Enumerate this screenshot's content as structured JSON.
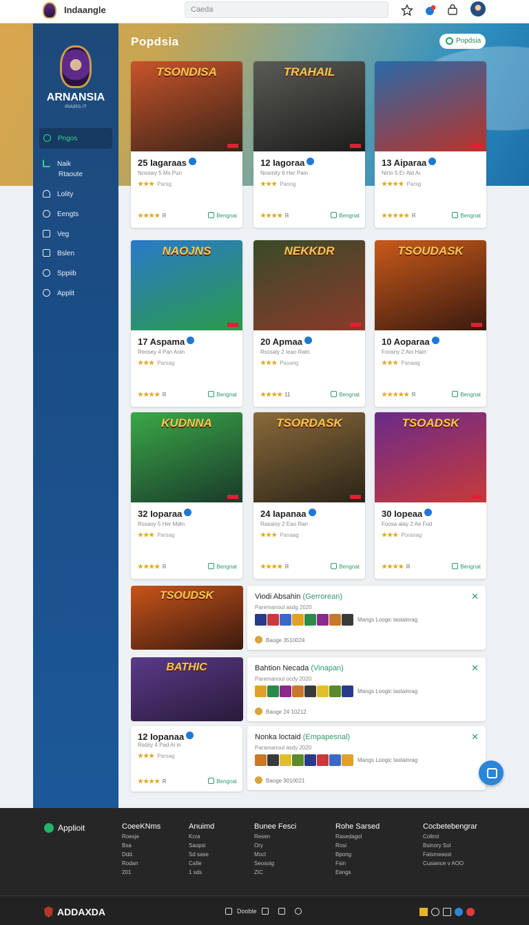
{
  "topbar": {
    "app_name": "Indaangle",
    "search_placeholder": "Caeda"
  },
  "hero": {
    "heading": "Popdsia",
    "button_label": "Popdsia"
  },
  "sidebar": {
    "title": "ARNANSIA",
    "subtitle": "IRAIRS·IT",
    "items": [
      {
        "label": "Pngos",
        "icon": "search-icon"
      },
      {
        "label": "Naik",
        "icon": "chart-icon"
      },
      {
        "label": "Rtaoute",
        "icon": ""
      },
      {
        "label": "Lolity",
        "icon": "user-icon"
      },
      {
        "label": "Eengts",
        "icon": "dollar-icon"
      },
      {
        "label": "Veg",
        "icon": "video-icon"
      },
      {
        "label": "Bslen",
        "icon": "list-icon"
      },
      {
        "label": "Sppiib",
        "icon": "play-icon"
      },
      {
        "label": "Applit",
        "icon": "link-icon"
      }
    ]
  },
  "cards": [
    {
      "art": "TSONDISA",
      "title": "25 Iagaraas",
      "meta": "Nosswy 5 Ms Pun",
      "stars": "★★★",
      "rating_note": "Parsg",
      "rating": "★★★★",
      "rating_count": "Я",
      "action": "Bengnat",
      "colors": [
        "#c8542a",
        "#3a2418"
      ]
    },
    {
      "art": "TRAHAIL",
      "title": "12 Iagoraa",
      "meta": "Nosmity 6 Her Pain",
      "stars": "★★★",
      "rating_note": "Panng",
      "rating": "★★★★",
      "rating_count": "Я",
      "action": "Bengnat",
      "colors": [
        "#5a5a56",
        "#1c1c1a"
      ]
    },
    {
      "art": "",
      "title": "13 Aiparaa",
      "meta": "Nirtn 5 Er Ald Ai",
      "stars": "★★★★",
      "rating_note": "Parsg",
      "rating": "★★★★★",
      "rating_count": "Я",
      "action": "Bengnat",
      "colors": [
        "#2a6aa8",
        "#b8332a"
      ]
    },
    {
      "art": "NAOJNS",
      "title": "17 Aspama",
      "meta": "Reosey 4 Pan Aoin",
      "stars": "★★★",
      "rating_note": "Parsag",
      "rating": "★★★★",
      "rating_count": "Я",
      "action": "Bengnat",
      "colors": [
        "#2a7ac8",
        "#2a9a4a"
      ]
    },
    {
      "art": "NEKKDR",
      "title": "20 Apmaa",
      "meta": "Rsssaly 2 Ieao Ratn",
      "stars": "★★★",
      "rating_note": "Pasang",
      "rating": "★★★★",
      "rating_count": "11",
      "action": "Bengnat",
      "colors": [
        "#3a4a2a",
        "#8a3a2a"
      ]
    },
    {
      "art": "TSOUDASK",
      "title": "10 Aoparaa",
      "meta": "Foosny 2 Aio Hain",
      "stars": "★★★",
      "rating_note": "Panaag",
      "rating": "★★★★★",
      "rating_count": "Я",
      "action": "Bengnat",
      "colors": [
        "#c85a1a",
        "#3a1a10"
      ]
    },
    {
      "art": "KUDNNA",
      "title": "32 Ioparaa",
      "meta": "Rssaoy 5 Her Mdin",
      "stars": "★★★",
      "rating_note": "Parsag",
      "rating": "★★★★",
      "rating_count": "Я",
      "action": "Bengnat",
      "colors": [
        "#3aa848",
        "#1a3a2a"
      ]
    },
    {
      "art": "TSORDASK",
      "title": "24 Iapanaa",
      "meta": "Rasaioy 2 Eao Ran",
      "stars": "★★★",
      "rating_note": "Panaag",
      "rating": "★★★★",
      "rating_count": "Я",
      "action": "Bengnat",
      "colors": [
        "#8a6a3a",
        "#2a2418"
      ]
    },
    {
      "art": "TSOADSK",
      "title": "30 Iopeaa",
      "meta": "Foosa alay 2 Ae Fod",
      "stars": "★★★",
      "rating_note": "Poranag",
      "rating": "★★★★",
      "rating_count": "Я",
      "action": "Bengnat",
      "colors": [
        "#6a2a8a",
        "#c83a3a"
      ]
    }
  ],
  "wide_images": [
    {
      "art": "TSOUDSK",
      "colors": [
        "#c8541a",
        "#3a1a10"
      ]
    },
    {
      "art": "BATHIC",
      "colors": [
        "#5a3a8a",
        "#2a1a3a"
      ]
    }
  ],
  "small_card": {
    "title": "12 Iopanaa",
    "meta": "Rsdsy 4 Pad Ai in",
    "stars": "★★★",
    "rating_note": "Parsag",
    "rating": "★★★★",
    "rating_count": "Я",
    "action": "Bengnat"
  },
  "list_cards": [
    {
      "title": "Viodi Absahin",
      "tag": "(Gerrorean)",
      "sub": "Paremanoul asdg 2020",
      "note": "Mangs Loogic tastainrag",
      "footer": "Baoge 3510024"
    },
    {
      "title": "Bahtion Necada",
      "tag": "(Vinapan)",
      "sub": "Paremanoul ocdy 2020",
      "note": "Mangs Loogic tastainrag",
      "footer": "Baoge 24 10212"
    },
    {
      "title": "Nonka loctaid",
      "tag": "(Empapesnal)",
      "sub": "Paramanoul asdy 2020",
      "note": "Mangs Loogic tastainrag",
      "footer": "Baoge 3010021"
    }
  ],
  "footer": {
    "brand": "Applioit",
    "columns": [
      {
        "heading": "CoeeKNms",
        "items": [
          "Roesje",
          "Bsa",
          "Ddd.",
          "Rodan",
          "201"
        ]
      },
      {
        "heading": "Anuimd",
        "items": [
          "Kcra",
          "Saopsi",
          "Sd sase",
          "Cafie",
          "1 sds"
        ]
      },
      {
        "heading": "Bunee Fesci",
        "items": [
          "Resen",
          "Ory",
          "Mocl",
          "Seosoig",
          "ZIC"
        ]
      },
      {
        "heading": "Rohe Sarsed",
        "items": [
          "Rasedagol",
          "Rosi",
          "Bpong",
          "Fsin",
          "Eengs"
        ]
      },
      {
        "heading": "Cocbetebengrar",
        "items": [
          "Coltrol",
          "Bsinory Sol",
          "Fatsmeasst",
          "Cusiance v AOO"
        ]
      }
    ],
    "bottom_logo": "ADDAXDA",
    "bottom_mid": "Dooble"
  }
}
